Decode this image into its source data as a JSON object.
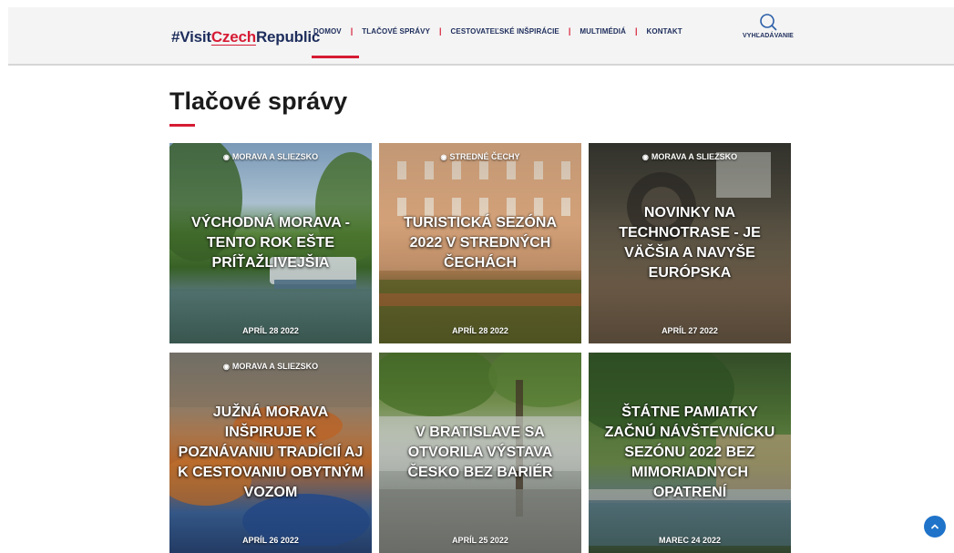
{
  "header": {
    "logo_prefix": "#Visit",
    "logo_highlight": "Czech",
    "logo_suffix": "Republic",
    "nav": [
      {
        "label": "DOMOV"
      },
      {
        "label": "TLAČOVÉ SPRÁVY"
      },
      {
        "label": "CESTOVATEĽSKÉ INŠPIRÁCIE"
      },
      {
        "label": "MULTIMÉDIÁ"
      },
      {
        "label": "KONTAKT"
      }
    ],
    "search_label": "VYHĽADÁVANIE",
    "search_icon": "search-icon"
  },
  "page": {
    "title": "Tlačové správy"
  },
  "cards": [
    {
      "region": "MORAVA A SLIEZSKO",
      "headline": "VÝCHODNÁ MORAVA - TENTO ROK EŠTE PRÍŤAŽLIVEJŠIA",
      "date": "APRÍL 28 2022"
    },
    {
      "region": "STREDNÉ ČECHY",
      "headline": "TURISTICKÁ SEZÓNA 2022 V STREDNÝCH ČECHÁCH",
      "date": "APRÍL 28 2022"
    },
    {
      "region": "MORAVA A SLIEZSKO",
      "headline": "NOVINKY NA TECHNOTRASE - JE VÄČŠIA A NAVYŠE EURÓPSKA",
      "date": "APRÍL 27 2022"
    },
    {
      "region": "MORAVA A SLIEZSKO",
      "headline": "JUŽNÁ MORAVA INŠPIRUJE K POZNÁVANIU TRADÍCIÍ AJ K CESTOVANIU OBYTNÝM VOZOM",
      "date": "APRÍL 26 2022"
    },
    {
      "region": "",
      "headline": "V BRATISLAVE SA OTVORILA VÝSTAVA ČESKO BEZ BARIÉR",
      "date": "APRÍL 25 2022"
    },
    {
      "region": "",
      "headline": "ŠTÁTNE PAMIATKY ZAČNÚ NÁVŠTEVNÍCKU SEZÓNU 2022 BEZ MIMORIADNYCH OPATRENÍ",
      "date": "MAREC 24 2022"
    }
  ],
  "colors": {
    "accent": "#d61b34",
    "brand": "#1d2d5c",
    "scroll_button": "#1f73c9"
  }
}
